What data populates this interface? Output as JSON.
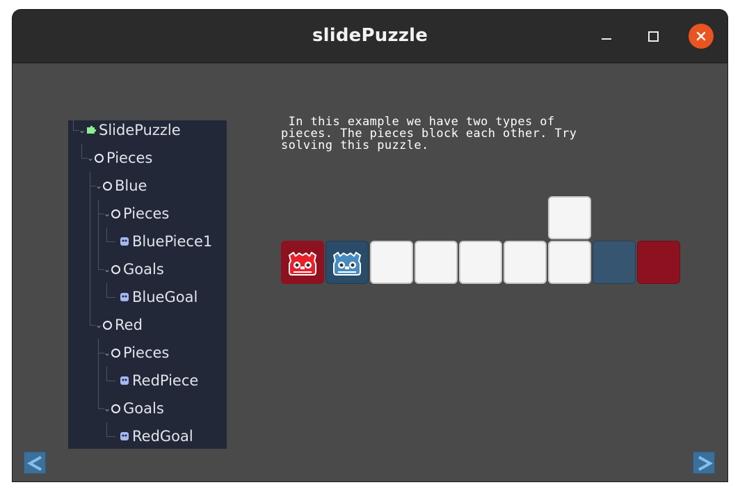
{
  "window": {
    "title": "slidePuzzle",
    "controls": [
      "minimize-icon",
      "maximize-icon",
      "close-icon"
    ],
    "close_color": "#e95420"
  },
  "scene_tree": {
    "nodes": [
      {
        "label": "SlidePuzzle",
        "icon": "puzzle-node-icon"
      },
      {
        "label": "Pieces",
        "icon": "node-ring-icon"
      },
      {
        "label": "Blue",
        "icon": "node-ring-icon"
      },
      {
        "label": "Pieces",
        "icon": "node-ring-icon"
      },
      {
        "label": "BluePiece1",
        "icon": "sprite-node-icon"
      },
      {
        "label": "Goals",
        "icon": "node-ring-icon"
      },
      {
        "label": "BlueGoal",
        "icon": "sprite-node-icon"
      },
      {
        "label": "Red",
        "icon": "node-ring-icon"
      },
      {
        "label": "Pieces",
        "icon": "node-ring-icon"
      },
      {
        "label": "RedPiece",
        "icon": "sprite-node-icon"
      },
      {
        "label": "Goals",
        "icon": "node-ring-icon"
      },
      {
        "label": "RedGoal",
        "icon": "sprite-node-icon"
      }
    ]
  },
  "description": {
    "line1": " In this example we have two types of",
    "line2": "pieces. The pieces block each other. Try",
    "line3": "solving this puzzle."
  },
  "board": {
    "pieces": [
      {
        "name": "red-piece",
        "icon": "godot-red-icon",
        "color": "#e8202a"
      },
      {
        "name": "blue-piece",
        "icon": "godot-blue-icon",
        "color": "#478cbf"
      }
    ],
    "goals": [
      {
        "name": "blue-goal",
        "color": "#355571"
      },
      {
        "name": "red-goal",
        "color": "#8e1120"
      }
    ]
  },
  "nav": {
    "prev": "<",
    "next": ">"
  }
}
